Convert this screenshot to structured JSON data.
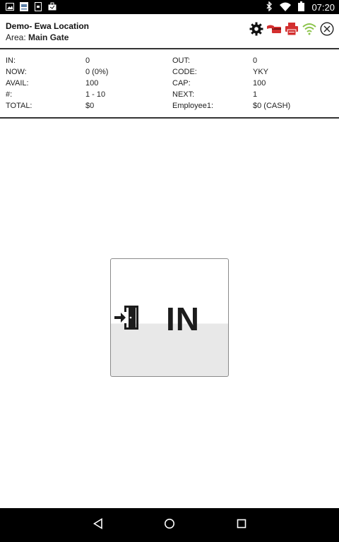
{
  "status_bar": {
    "time": "07:20",
    "icons": [
      "image-icon",
      "badge-icon",
      "sim-icon",
      "briefcase-icon",
      "bluetooth-icon",
      "wifi-icon",
      "battery-icon"
    ]
  },
  "header": {
    "location": "Demo- Ewa Location",
    "area_label": "Area:",
    "area_value": "Main Gate",
    "icons": [
      "gear-icon",
      "card-payment-icon",
      "printer-icon",
      "wifi-signal-icon",
      "close-circle-icon"
    ],
    "colors": {
      "printer": "#d32f2f",
      "wifi": "#8bc34a"
    }
  },
  "stats": {
    "in_label": "IN:",
    "in_value": "0",
    "out_label": "OUT:",
    "out_value": "0",
    "now_label": "NOW:",
    "now_value": "0 (0%)",
    "code_label": "CODE:",
    "code_value": "YKY",
    "avail_label": "AVAIL:",
    "avail_value": "100",
    "cap_label": "CAP:",
    "cap_value": "100",
    "num_label": "#:",
    "num_value": "1 - 10",
    "next_label": "NEXT:",
    "next_value": "1",
    "total_label": "TOTAL:",
    "total_value": "$0",
    "employee_label": "Employee1:",
    "employee_value": "$0 (CASH)"
  },
  "main_button": {
    "label": "IN",
    "icon": "enter-door-icon"
  },
  "nav_bar": {
    "buttons": [
      "back-icon",
      "home-icon",
      "recents-icon"
    ]
  }
}
